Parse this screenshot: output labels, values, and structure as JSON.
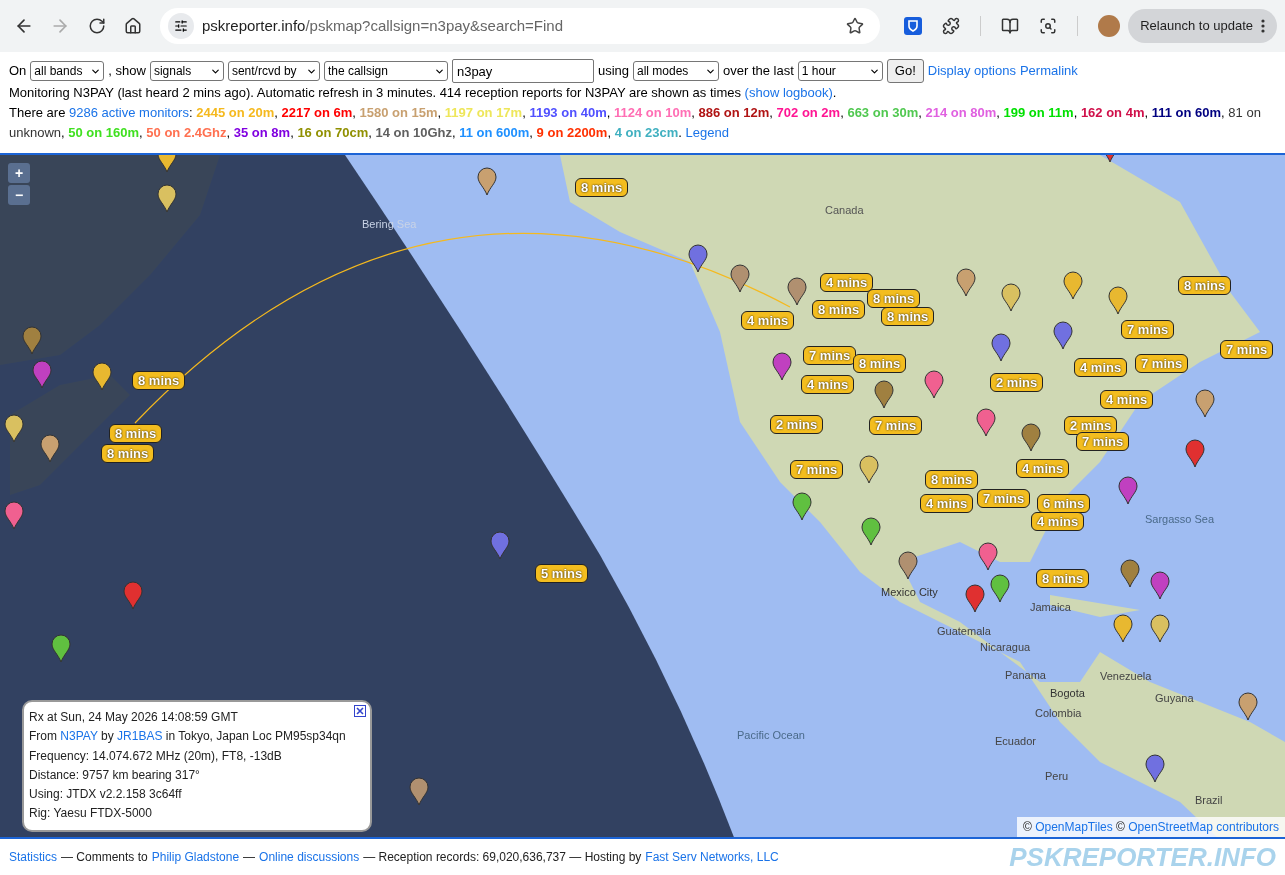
{
  "browser": {
    "url_host": "pskreporter.info",
    "url_path": "/pskmap?callsign=n3pay&search=Find",
    "relaunch_button": "Relaunch to update"
  },
  "controls": {
    "on_label": "On",
    "band_select": "all bands",
    "show_label": ", show",
    "show_select": "signals",
    "direction_select": "sent/rcvd by",
    "target_select": "the callsign",
    "callsign_input": "n3pay",
    "using_label": "using",
    "mode_select": "all modes",
    "over_label": "over the last",
    "period_select": "1 hour",
    "go_button": "Go!",
    "display_options_link": "Display options",
    "permalink_link": "Permalink"
  },
  "status": {
    "text": "Monitoring N3PAY (last heard 2 mins ago). Automatic refresh in 3 minutes. 414 reception reports for N3PAY are shown as times",
    "logbook_link": "(show logbook)",
    "end": "."
  },
  "summary": {
    "intro": "There are",
    "monitors_link": "9286 active monitors",
    "colon": ":",
    "separator": ",",
    "end": ".",
    "legend_link": "Legend",
    "bands": [
      {
        "kind": "band",
        "text": "2445 on 20m",
        "color": "#f5b91e"
      },
      {
        "kind": "band",
        "text": "2217 on 6m",
        "color": "#ff0000"
      },
      {
        "kind": "band",
        "text": "1580 on 15m",
        "color": "#c8a070"
      },
      {
        "kind": "band",
        "text": "1197 on 17m",
        "color": "#eee65a"
      },
      {
        "kind": "band",
        "text": "1193 on 40m",
        "color": "#5050ff"
      },
      {
        "kind": "band",
        "text": "1124 on 10m",
        "color": "#ff6eb4"
      },
      {
        "kind": "band",
        "text": "886 on 12m",
        "color": "#b01414"
      },
      {
        "kind": "band",
        "text": "702 on 2m",
        "color": "#ff1493"
      },
      {
        "kind": "band",
        "text": "663 on 30m",
        "color": "#50c850"
      },
      {
        "kind": "band",
        "text": "214 on 80m",
        "color": "#e060e0"
      },
      {
        "kind": "band",
        "text": "199 on 11m",
        "color": "#00e000"
      },
      {
        "kind": "band",
        "text": "162 on 4m",
        "color": "#d0104a"
      },
      {
        "kind": "band",
        "text": "111 on 60m",
        "color": "#000080"
      },
      {
        "kind": "plain",
        "text": "81 on unknown",
        "color": "#333333"
      },
      {
        "kind": "band",
        "text": "50 on 160m",
        "color": "#40e020"
      },
      {
        "kind": "band",
        "text": "50 on 2.4Ghz",
        "color": "#ff7050"
      },
      {
        "kind": "band",
        "text": "35 on 8m",
        "color": "#8000e0"
      },
      {
        "kind": "band",
        "text": "16 on 70cm",
        "color": "#909000"
      },
      {
        "kind": "band",
        "text": "14 on 10Ghz",
        "color": "#606060"
      },
      {
        "kind": "band",
        "text": "11 on 600m",
        "color": "#1e90ff"
      },
      {
        "kind": "band",
        "text": "9 on 2200m",
        "color": "#ff3000"
      },
      {
        "kind": "band",
        "text": "4 on 23cm",
        "color": "#40b0c0"
      }
    ]
  },
  "map": {
    "zoom_in": "+",
    "zoom_out": "−",
    "place_labels": [
      "Bering Sea",
      "Canada",
      "Sargasso Sea",
      "Mexico City",
      "Jamaica",
      "Guatemala",
      "Nicaragua",
      "Panama",
      "Venezuela",
      "Guyana",
      "Bogota",
      "Colombia",
      "Ecuador",
      "Peru",
      "Brazil",
      "Pacific Ocean"
    ],
    "time_labels": [
      "8 mins",
      "8 mins",
      "4 mins",
      "8 mins",
      "8 mins",
      "8 mins",
      "4 mins",
      "7 mins",
      "7 mins",
      "7 mins",
      "8 mins",
      "8 mins",
      "4 mins",
      "2 mins",
      "4 mins",
      "7 mins",
      "4 mins",
      "2 mins",
      "7 mins",
      "2 mins",
      "7 mins",
      "8 mins",
      "8 mins",
      "4 mins",
      "7 mins",
      "8 mins",
      "4 mins",
      "7 mins",
      "6 mins",
      "4 mins",
      "8 mins",
      "5 mins"
    ],
    "attribution": {
      "copyright": "©",
      "links": [
        "OpenMapTiles",
        "OpenStreetMap contributors"
      ]
    }
  },
  "popup": {
    "time": "Rx at Sun, 24 May 2026 14:08:59 GMT",
    "from_label": "From",
    "sender": "N3PAY",
    "by_label": "by",
    "receiver": "JR1BAS",
    "location": "in Tokyo, Japan Loc PM95sp34qn",
    "details": [
      "Frequency: 14.074.672 MHz (20m), FT8, -13dB",
      "Distance: 9757 km bearing 317°",
      "Using: JTDX v2.2.158 3c64ff",
      "Rig: Yaesu FTDX-5000"
    ]
  },
  "footer": {
    "items": [
      {
        "kind": "link",
        "text": "Statistics"
      },
      {
        "kind": "text",
        "text": "— Comments to"
      },
      {
        "kind": "link",
        "text": "Philip Gladstone"
      },
      {
        "kind": "text",
        "text": "—"
      },
      {
        "kind": "link",
        "text": "Online discussions"
      },
      {
        "kind": "text",
        "text": "— Reception records: 69,020,636,737 — Hosting by"
      },
      {
        "kind": "link",
        "text": "Fast Serv Networks, LLC"
      }
    ],
    "logo": "PSKREPORTER.INFO"
  }
}
